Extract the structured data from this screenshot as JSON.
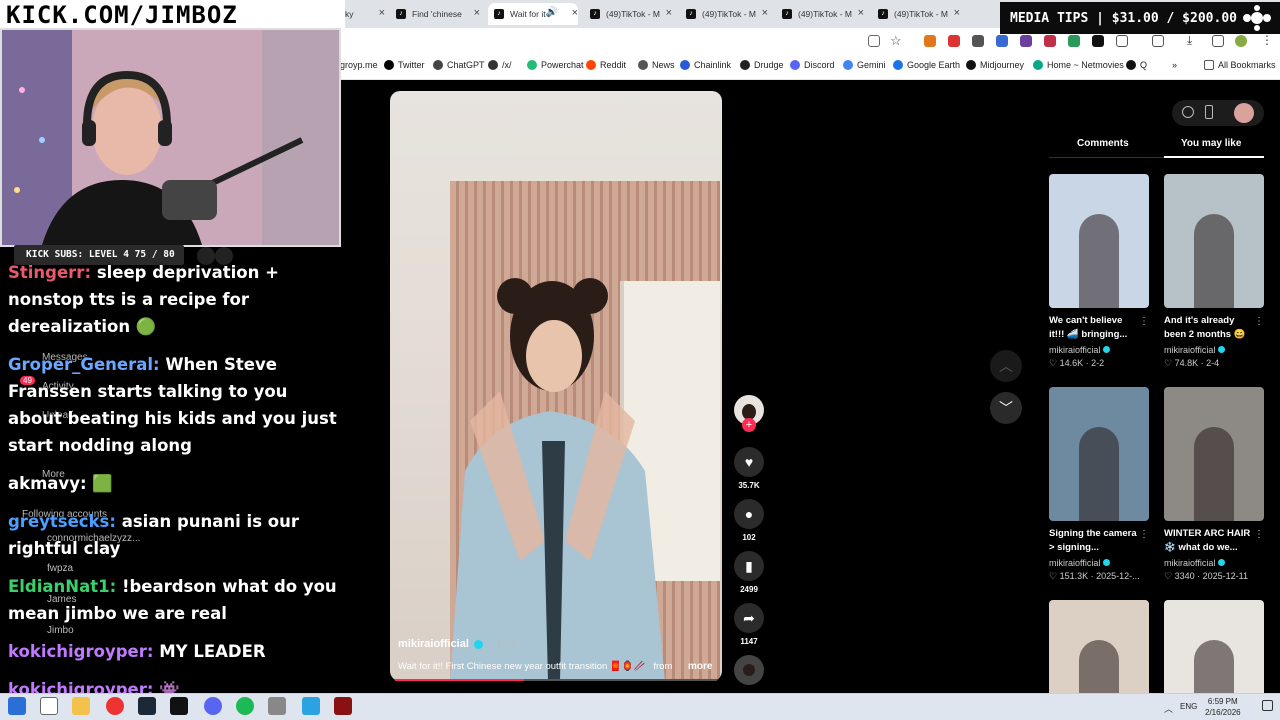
{
  "browser": {
    "tabs": [
      {
        "label": "ky",
        "active": false
      },
      {
        "label": "Find 'chinese",
        "active": false
      },
      {
        "label": "Wait for it",
        "active": true
      },
      {
        "label": "(49)TikTok - M",
        "active": false
      },
      {
        "label": "(49)TikTok - M",
        "active": false
      },
      {
        "label": "(49)TikTok - M",
        "active": false
      },
      {
        "label": "(49)TikTok - M",
        "active": false
      }
    ],
    "bookmarks": [
      {
        "label": "groyp.me",
        "color": "#888"
      },
      {
        "label": "Twitter",
        "color": "#000"
      },
      {
        "label": "ChatGPT",
        "color": "#444"
      },
      {
        "label": "/x/",
        "color": "#333"
      },
      {
        "label": "Powerchat",
        "color": "#2b7"
      },
      {
        "label": "Reddit",
        "color": "#ff4500"
      },
      {
        "label": "News",
        "color": "#555"
      },
      {
        "label": "Chainlink",
        "color": "#2a5ada"
      },
      {
        "label": "Drudge",
        "color": "#222"
      },
      {
        "label": "Discord",
        "color": "#5865f2"
      },
      {
        "label": "Gemini",
        "color": "#4285f4"
      },
      {
        "label": "Google Earth",
        "color": "#1a73e8"
      },
      {
        "label": "Midjourney",
        "color": "#111"
      },
      {
        "label": "Home ~ Netmovies",
        "color": "#0a8"
      },
      {
        "label": "Q",
        "color": "#111"
      }
    ],
    "all_bookmarks": "All Bookmarks",
    "overflow": "»"
  },
  "media_tips": "MEDIA TIPS | $31.00 / $200.00",
  "stream": {
    "banner": "KICK.COM/JIMBOZ",
    "subs": "KICK SUBS: LEVEL 4 75 / 80",
    "chat": [
      {
        "user": "Stingerr:",
        "user_color": "#e85a6a",
        "text": "sleep deprivation + nonstop tts is a recipe for derealization 🟢",
        "rows": 3
      },
      {
        "user": "Groper_General:",
        "user_color": "#6aa8ff",
        "text": "When Steve Franssen starts talking to you about beating his kids and you just start nodding along",
        "rows": 4
      },
      {
        "user": "akmavy:",
        "user_color": "#ffffff",
        "text": "🟩",
        "rows": 1
      },
      {
        "user": "greytsecks:",
        "user_color": "#4aa0ff",
        "text": "asian punani is our rightful clay",
        "rows": 2
      },
      {
        "user": "EldianNat1:",
        "user_color": "#3ad06a",
        "text": "!beardson what do you mean jimbo we are real",
        "rows": 2
      },
      {
        "user": "kokichigroyper:",
        "user_color": "#c07aff",
        "text": "MY LEADER",
        "rows": 1
      },
      {
        "user": "kokichigroyper:",
        "user_color": "#c07aff",
        "text": "👾",
        "rows": 1
      }
    ],
    "ghost_menu": [
      "Messages",
      "Activity",
      "Upload",
      "More",
      "Following accounts",
      "connormichaelzyzz...",
      "fwpza",
      "James",
      "Jimbo"
    ],
    "ghost_badge": "49"
  },
  "video": {
    "author": "mikiraiofficial",
    "date": "· 1-19",
    "caption": "Wait for it!! First Chinese new year outfit transition 🧧🏮🥢",
    "from": "from",
    "more": "more",
    "progress": 0.4,
    "actions": {
      "likes": "35.7K",
      "comments": "102",
      "saves": "2499",
      "shares": "1147"
    }
  },
  "side": {
    "tabs": [
      "Comments",
      "You may like"
    ],
    "active_tab": "You may like",
    "cards": [
      {
        "title": "We can't believe it!!! 🚄 bringing...",
        "author": "mikiraiofficial",
        "stats": "♡ 14.6K · 2-2",
        "bg": "#c9d6e6"
      },
      {
        "title": "And it's already been 2 months 😄",
        "author": "mikiraiofficial",
        "stats": "♡ 74.8K · 2-4",
        "bg": "#b6c2c7"
      },
      {
        "title": "Signing the camera > signing...",
        "author": "mikiraiofficial",
        "stats": "♡ 151.3K · 2025-12-...",
        "bg": "#6d8aa0"
      },
      {
        "title": "WINTER ARC HAIR ❄️ what do we...",
        "author": "mikiraiofficial",
        "stats": "♡ 3340 · 2025-12-11",
        "bg": "#8d8a86"
      },
      {
        "title": "",
        "author": "",
        "stats": "",
        "bg": "#dcd0c4"
      },
      {
        "title": "",
        "author": "",
        "stats": "",
        "bg": "#e8e4e0"
      }
    ]
  },
  "taskbar": {
    "lang": "ENG",
    "time": "6:59 PM",
    "date": "2/16/2026"
  }
}
